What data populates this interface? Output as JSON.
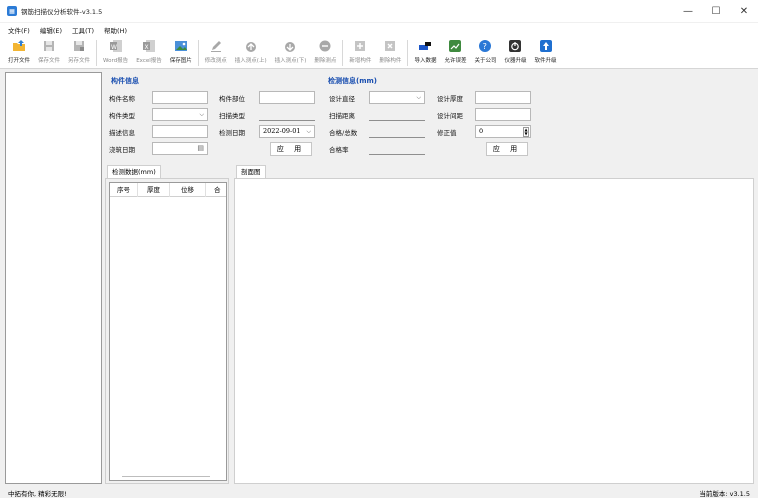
{
  "window": {
    "title": "钢筋扫描仪分析软件-v3.1.5",
    "controls": {
      "minimize": "—",
      "maximize": "☐",
      "close": "✕"
    }
  },
  "menu": [
    "文件(F)",
    "编辑(E)",
    "工具(T)",
    "帮助(H)"
  ],
  "toolbar": [
    {
      "label": "打开文件",
      "icon": "folder-open-icon",
      "enabled": true,
      "color": "#e8a317"
    },
    {
      "label": "保存文件",
      "icon": "save-icon",
      "enabled": false,
      "color": "#9a9a9a"
    },
    {
      "label": "另存文件",
      "icon": "save-as-icon",
      "enabled": false,
      "color": "#9a9a9a"
    },
    {
      "label": "Word报告",
      "icon": "word-icon",
      "enabled": false,
      "color": "#9a9a9a"
    },
    {
      "label": "Excel报告",
      "icon": "excel-icon",
      "enabled": false,
      "color": "#9a9a9a"
    },
    {
      "label": "保存图片",
      "icon": "image-icon",
      "enabled": true,
      "color": "#2f7fd1"
    },
    {
      "label": "修改测点",
      "icon": "edit-point-icon",
      "enabled": false,
      "color": "#9a9a9a"
    },
    {
      "label": "插入测点(上)",
      "icon": "insert-up-icon",
      "enabled": false,
      "color": "#9a9a9a"
    },
    {
      "label": "插入测点(下)",
      "icon": "insert-down-icon",
      "enabled": false,
      "color": "#9a9a9a"
    },
    {
      "label": "删除测点",
      "icon": "delete-point-icon",
      "enabled": false,
      "color": "#9a9a9a"
    },
    {
      "label": "新增构件",
      "icon": "add-component-icon",
      "enabled": false,
      "color": "#9a9a9a"
    },
    {
      "label": "删除构件",
      "icon": "delete-component-icon",
      "enabled": false,
      "color": "#9a9a9a"
    },
    {
      "label": "导入数据",
      "icon": "import-data-icon",
      "enabled": true,
      "color": "#1b56c8"
    },
    {
      "label": "允许误差",
      "icon": "tolerance-icon",
      "enabled": true,
      "color": "#3f8a3f"
    },
    {
      "label": "关于公司",
      "icon": "about-icon",
      "enabled": true,
      "color": "#2a78d6"
    },
    {
      "label": "仪器升级",
      "icon": "device-upgrade-icon",
      "enabled": true,
      "color": "#333333"
    },
    {
      "label": "软件升级",
      "icon": "software-upgrade-icon",
      "enabled": true,
      "color": "#1f6fd0"
    }
  ],
  "component_info": {
    "title": "构件信息",
    "name_label": "构件名称",
    "name_value": "",
    "part_label": "构件部位",
    "part_value": "",
    "type_label": "构件类型",
    "type_value": "",
    "scan_type_label": "扫描类型",
    "scan_type_value": "",
    "desc_label": "描述信息",
    "desc_value": "",
    "date_label": "检测日期",
    "date_value": "2022-09-01",
    "pour_label": "浇筑日期",
    "pour_value": "",
    "apply_button": "应 用"
  },
  "detection_info": {
    "title": "检测信息(mm)",
    "diameter_label": "设计直径",
    "diameter_value": "",
    "thickness_label": "设计厚度",
    "thickness_value": "",
    "distance_label": "扫描距离",
    "distance_value": "",
    "spacing_label": "设计间距",
    "spacing_value": "",
    "pass_total_label": "合格/总数",
    "pass_total_value": "",
    "correction_label": "修正值",
    "correction_value": "0",
    "pass_rate_label": "合格率",
    "pass_rate_value": "",
    "apply_button": "应 用"
  },
  "tabs": {
    "data": "检测数据(mm)",
    "section": "剖面图"
  },
  "table": {
    "columns": [
      "序号",
      "厚度",
      "位移",
      "合"
    ]
  },
  "status": {
    "left": "中拓有你, 精彩无限!",
    "right": "当前版本: v3.1.5"
  }
}
